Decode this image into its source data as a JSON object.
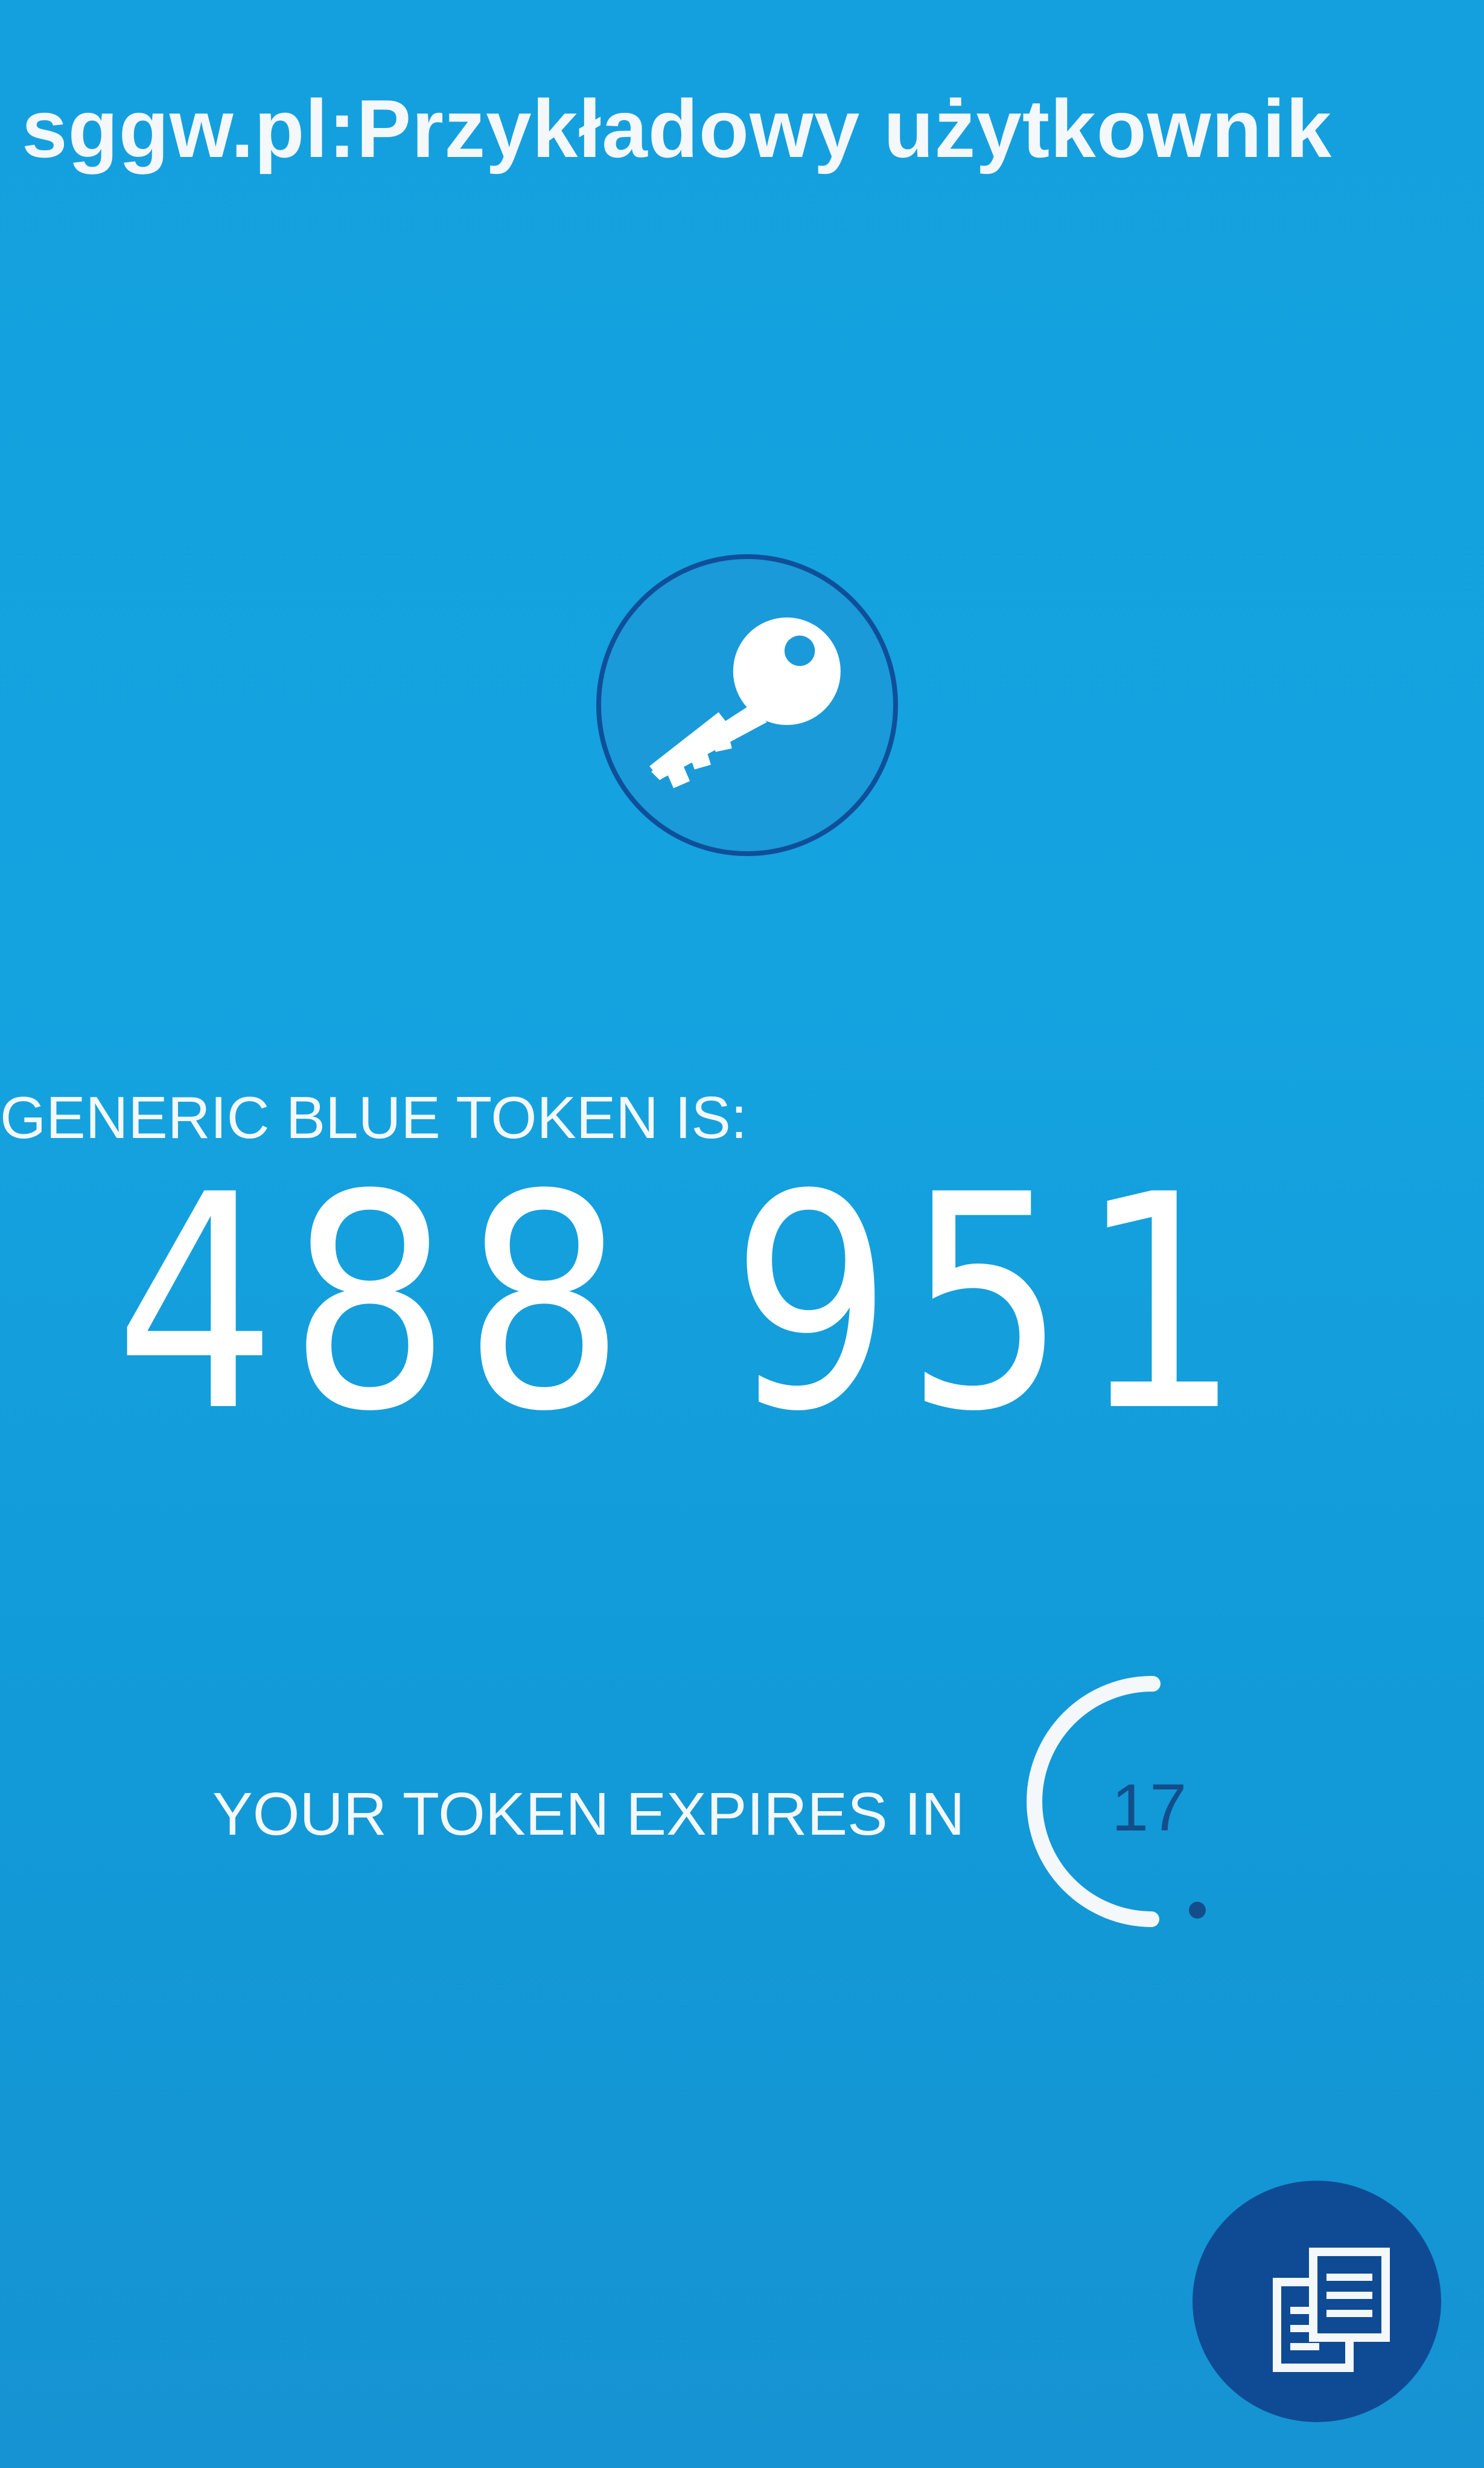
{
  "account": {
    "title": "sggw.pl:Przykładowy użytkownik"
  },
  "token": {
    "label": "GENERIC BLUE TOKEN IS:",
    "code": "488 951"
  },
  "expiry": {
    "label": "YOUR TOKEN EXPIRES IN",
    "seconds_remaining": "17"
  },
  "icons": {
    "key": "key-icon",
    "copy": "copy-icon"
  },
  "colors": {
    "background": "#15a3e0",
    "accent_dark": "#0f4b95",
    "text": "#ffffff",
    "countdown_text": "#134e8a"
  }
}
